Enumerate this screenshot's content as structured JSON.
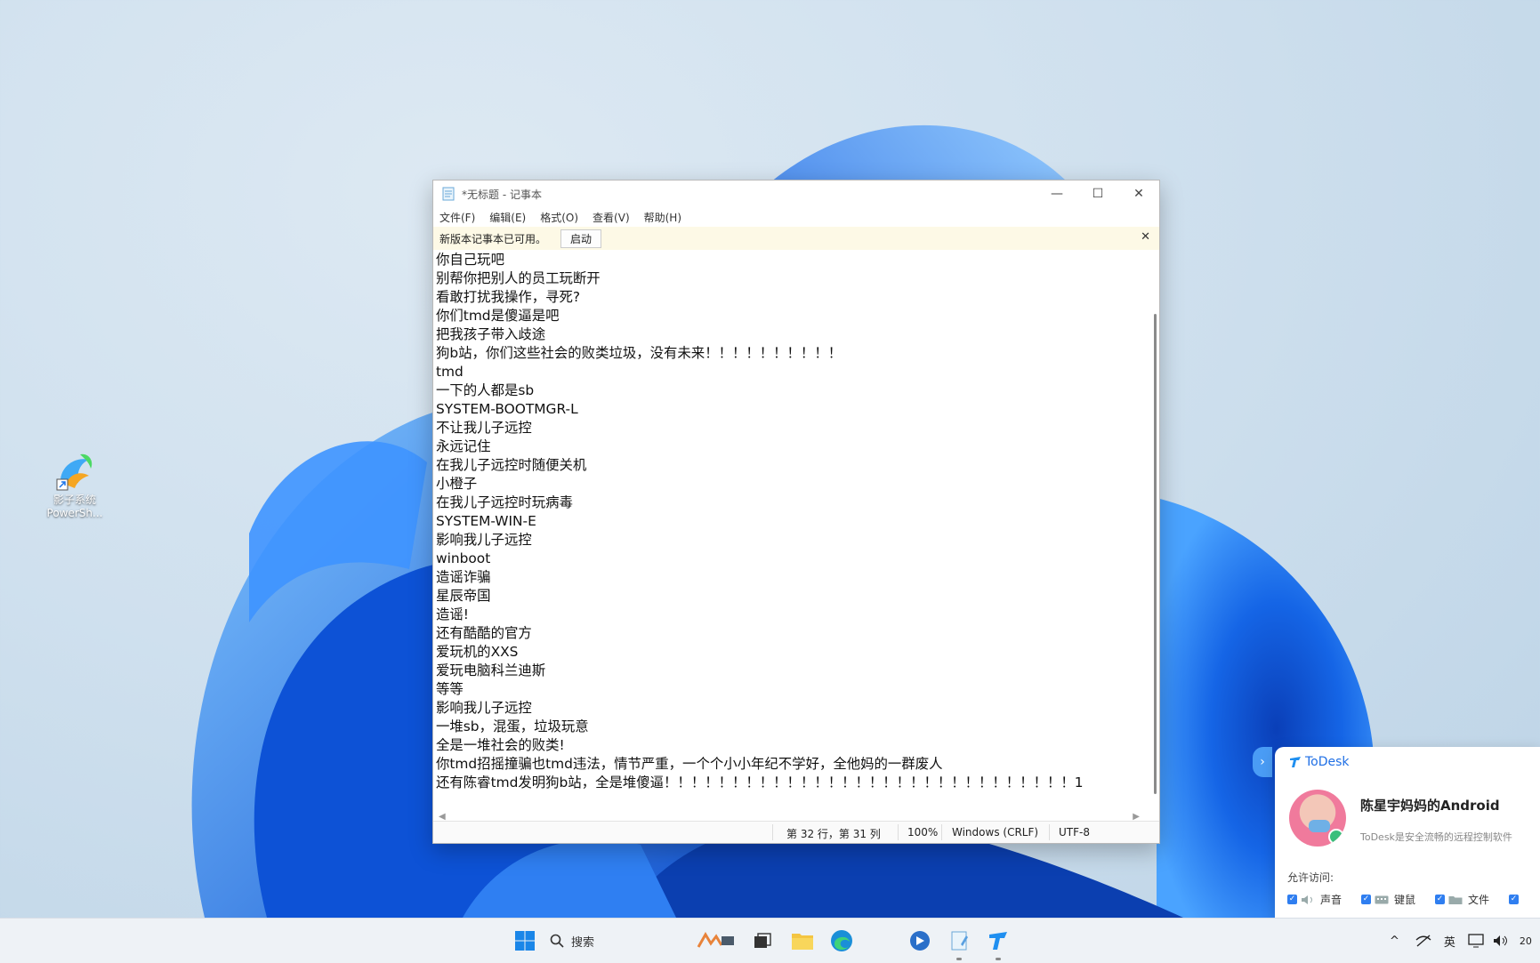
{
  "desktop": {
    "icons": [
      {
        "label_line1": "影子系统",
        "label_line2": "PowerSh..."
      }
    ]
  },
  "notepad": {
    "title": "*无标题 - 记事本",
    "window_controls": {
      "minimize": "—",
      "maximize": "☐",
      "close": "✕"
    },
    "menu": [
      "文件(F)",
      "编辑(E)",
      "格式(O)",
      "查看(V)",
      "帮助(H)"
    ],
    "notice": {
      "text": "新版本记事本已可用。",
      "button": "启动",
      "close": "✕"
    },
    "lines": [
      "你自己玩吧",
      "别帮你把别人的员工玩断开",
      "看敢打扰我操作，寻死?",
      "你们tmd是傻逼是吧",
      "把我孩子带入歧途",
      "狗b站，你们这些社会的败类垃圾，没有未来！！！！！！！！！！",
      "tmd",
      "一下的人都是sb",
      "SYSTEM-BOOTMGR-L",
      "不让我儿子远控",
      "永远记住",
      "在我儿子远控时随便关机",
      "小橙子",
      "在我儿子远控时玩病毒",
      "SYSTEM-WIN-E",
      "影响我儿子远控",
      "winboot",
      "造谣诈骗",
      "星辰帝国",
      "造谣!",
      "还有酷酷的官方",
      "爱玩机的XXS",
      "爱玩电脑科兰迪斯",
      "等等",
      "影响我儿子远控",
      "一堆sb，混蛋，垃圾玩意",
      "全是一堆社会的败类!",
      "你tmd招摇撞骗也tmd违法，情节严重，一个个小小年纪不学好，全他妈的一群废人",
      "还有陈睿tmd发明狗b站，全是堆傻逼！！！！！！！！！！！！！！！！！！！！！！！！！！！！！！1"
    ],
    "status": {
      "position": "第 32 行，第 31 列",
      "zoom": "100%",
      "line_ending": "Windows (CRLF)",
      "encoding": "UTF-8"
    }
  },
  "todesk": {
    "tab_glyph": "›",
    "brand": "ToDesk",
    "device_name": "陈星宇妈妈的Android",
    "description": "ToDesk是安全流畅的远程控制软件",
    "permissions_label": "允许访问:",
    "permissions": [
      "声音",
      "键鼠",
      "文件"
    ]
  },
  "taskbar": {
    "search_placeholder": "搜索",
    "tray": {
      "chevron": "^",
      "ime": "英",
      "clock_partial": "20"
    }
  },
  "colors": {
    "accent": "#1f6fe5",
    "notice_bg": "#fdf9e6",
    "bloom_blue": "#1a73e8"
  }
}
